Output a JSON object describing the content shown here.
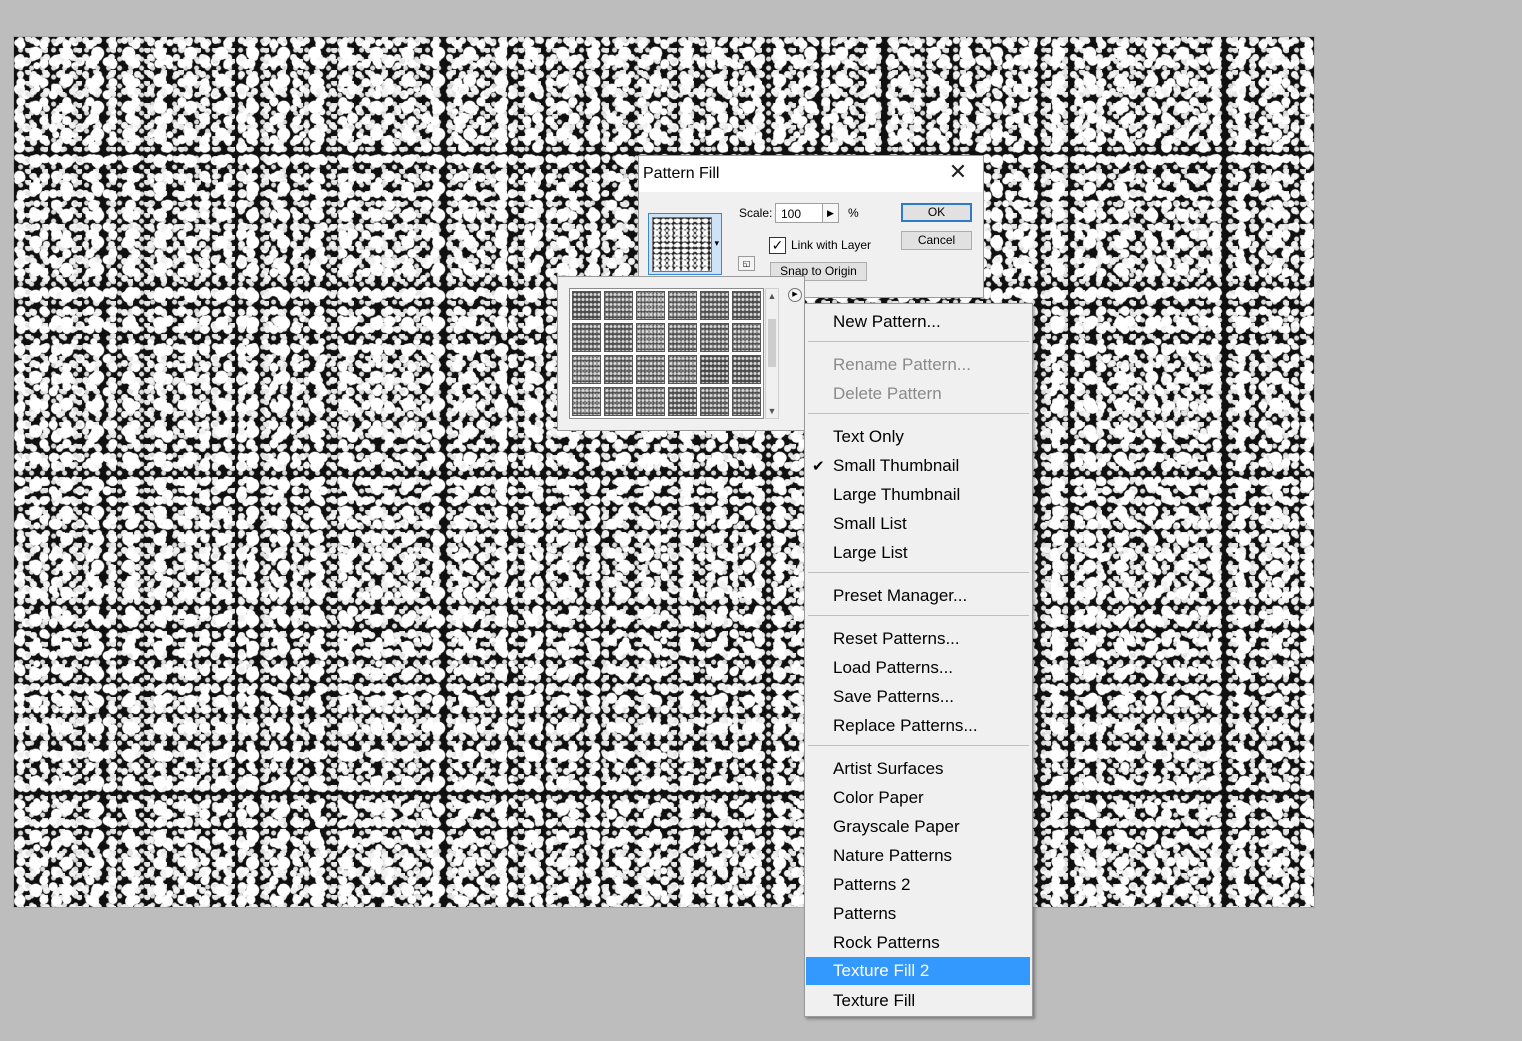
{
  "dialog": {
    "title": "Pattern Fill",
    "close_glyph": "✕",
    "scale_label": "Scale:",
    "scale_value": "100",
    "scale_unit": "%",
    "link_with_layer_label": "Link with Layer",
    "link_with_layer_checked": true,
    "snap_to_origin_label": "Snap to Origin",
    "ok_label": "OK",
    "cancel_label": "Cancel"
  },
  "menu": {
    "items": [
      {
        "label": "New Pattern...",
        "state": "enabled"
      },
      {
        "label": "Rename Pattern...",
        "state": "disabled"
      },
      {
        "label": "Delete Pattern",
        "state": "disabled"
      },
      {
        "label": "Text Only",
        "state": "enabled"
      },
      {
        "label": "Small Thumbnail",
        "state": "checked"
      },
      {
        "label": "Large Thumbnail",
        "state": "enabled"
      },
      {
        "label": "Small List",
        "state": "enabled"
      },
      {
        "label": "Large List",
        "state": "enabled"
      },
      {
        "label": "Preset Manager...",
        "state": "enabled"
      },
      {
        "label": "Reset Patterns...",
        "state": "enabled"
      },
      {
        "label": "Load Patterns...",
        "state": "enabled"
      },
      {
        "label": "Save Patterns...",
        "state": "enabled"
      },
      {
        "label": "Replace Patterns...",
        "state": "enabled"
      },
      {
        "label": "Artist Surfaces",
        "state": "enabled"
      },
      {
        "label": "Color Paper",
        "state": "enabled"
      },
      {
        "label": "Grayscale Paper",
        "state": "enabled"
      },
      {
        "label": "Nature Patterns",
        "state": "enabled"
      },
      {
        "label": "Patterns 2",
        "state": "enabled"
      },
      {
        "label": "Patterns",
        "state": "enabled"
      },
      {
        "label": "Rock Patterns",
        "state": "enabled"
      },
      {
        "label": "Texture Fill 2",
        "state": "highlighted"
      },
      {
        "label": "Texture Fill",
        "state": "enabled"
      }
    ],
    "check_glyph": "✔"
  },
  "icons": {
    "scale_arrow": "▶",
    "dropdown_caret": "▾",
    "scroll_up": "▲",
    "scroll_down": "▼",
    "flyout": "▶",
    "checkbox_mark": "✓",
    "small_icon": "◱"
  },
  "colors": {
    "highlight": "#3399ff",
    "default_button_border": "#2f7ac9",
    "canvas_bg": "#bdbdbd"
  }
}
